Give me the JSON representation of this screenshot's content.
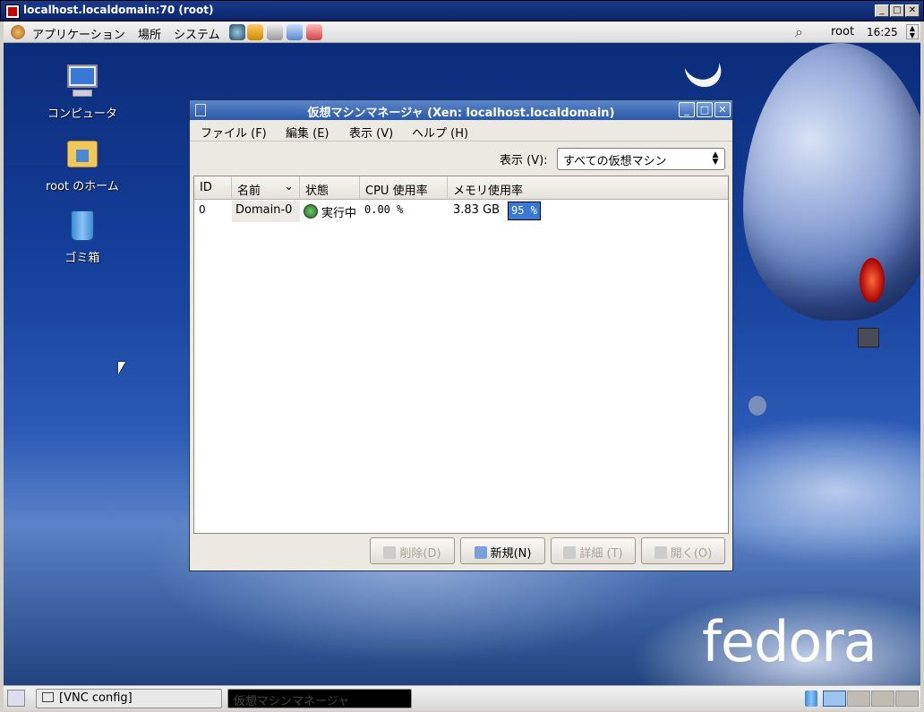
{
  "vnc": {
    "title": "localhost.localdomain:70 (root)"
  },
  "top_panel": {
    "menus": [
      "アプリケーション",
      "場所",
      "システム"
    ],
    "user": "root",
    "clock": "16:25"
  },
  "desktop": {
    "icons": [
      {
        "label": "コンピュータ",
        "icon": "computer-icon"
      },
      {
        "label": "root のホーム",
        "icon": "home-folder-icon"
      },
      {
        "label": "ゴミ箱",
        "icon": "trash-icon"
      }
    ],
    "brand": "fedora"
  },
  "app": {
    "title": "仮想マシンマネージャ (Xen: localhost.localdomain)",
    "menus": [
      "ファイル (F)",
      "編集 (E)",
      "表示 (V)",
      "ヘルプ (H)"
    ],
    "view_label": "表示 (V):",
    "view_select": "すべての仮想マシン",
    "columns": [
      "ID",
      "名前",
      "状態",
      "CPU 使用率",
      "メモリ使用率"
    ],
    "rows": [
      {
        "id": "0",
        "name": "Domain-0",
        "state": "実行中",
        "cpu": "0.00 %",
        "mem": "3.83 GB",
        "mem_pct": "95 %"
      }
    ],
    "buttons": {
      "delete": "削除(D)",
      "new": "新規(N)",
      "details": "詳細 (T)",
      "open": "開く(O)"
    }
  },
  "bottom_panel": {
    "tasks": [
      "[VNC config]",
      "仮想マシンマネージャ"
    ]
  }
}
